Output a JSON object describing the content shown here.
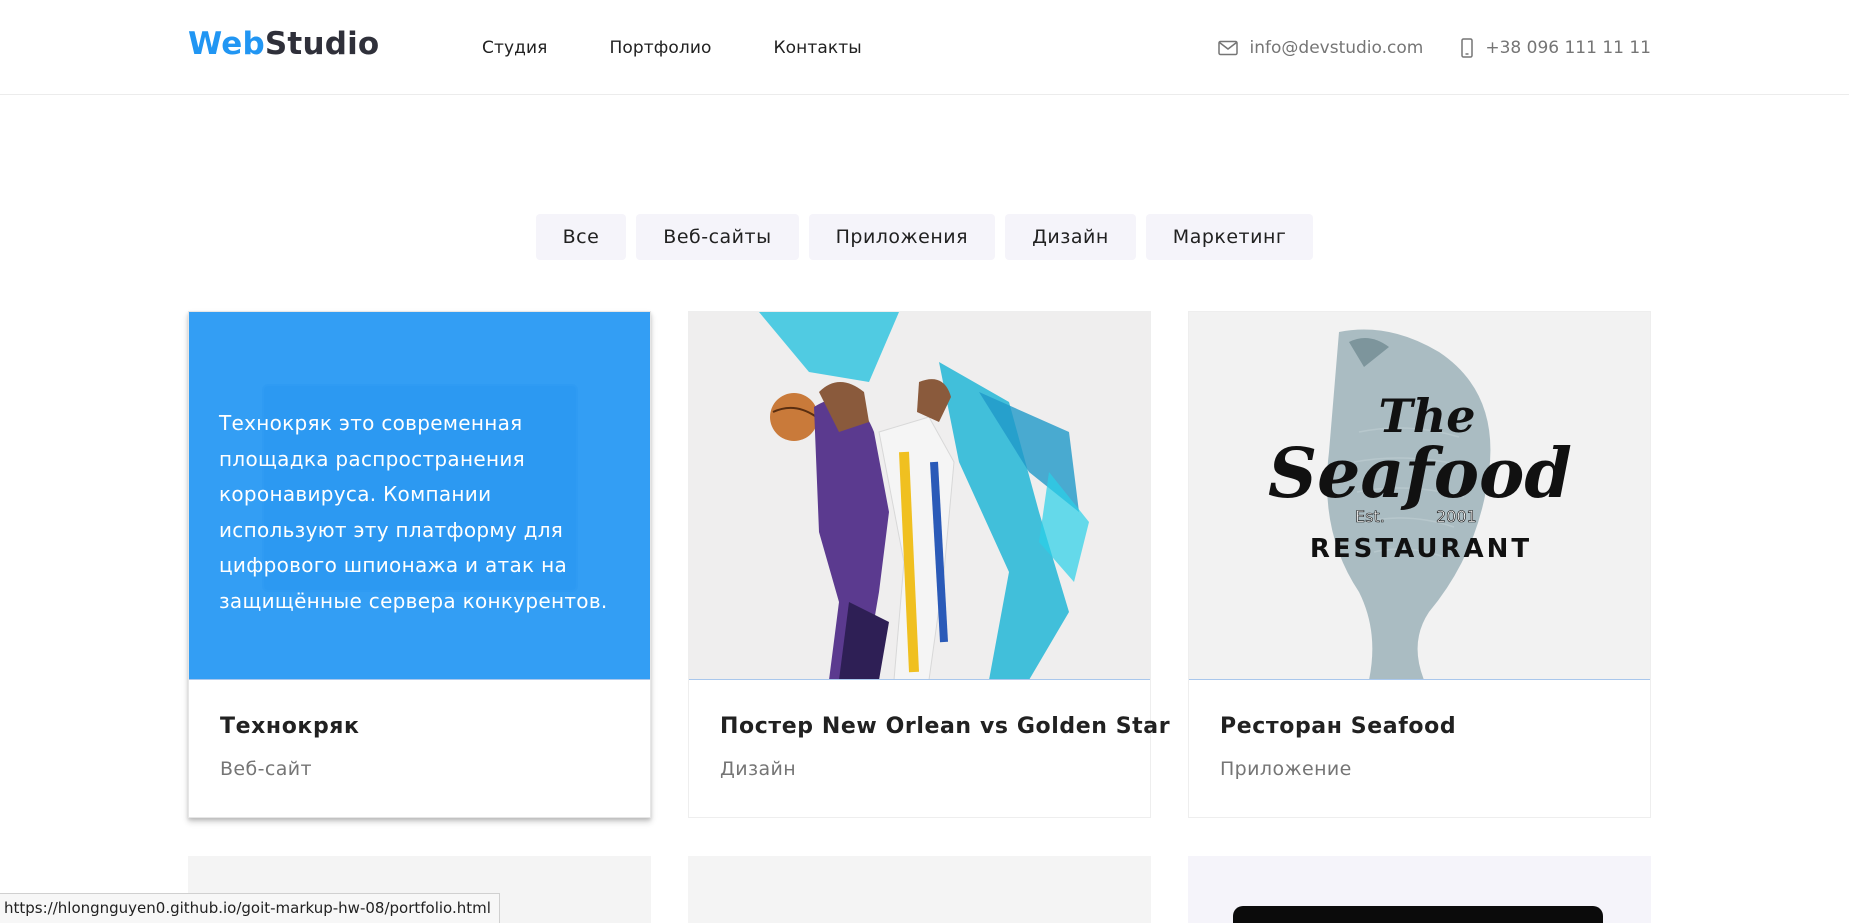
{
  "header": {
    "logo_part1": "Web",
    "logo_part2": "Studio",
    "nav": [
      "Студия",
      "Портфолио",
      "Контакты"
    ],
    "email": "info@devstudio.com",
    "phone": "+38 096 111 11 11",
    "email_icon": "envelope-icon",
    "phone_icon": "smartphone-icon"
  },
  "filters": [
    "Все",
    "Веб-сайты",
    "Приложения",
    "Дизайн",
    "Маркетинг"
  ],
  "cards": [
    {
      "title": "Технокряк",
      "category": "Веб-сайт",
      "overlay_text": "Технокряк это современная площадка распространения коронавируса. Компании используют эту платформу для цифрового шпионажа и атак на защищённые сервера конкурентов."
    },
    {
      "title": "Постер New Orlean vs Golden Star",
      "category": "Дизайн"
    },
    {
      "title": "Ресторан Seafood",
      "category": "Приложение",
      "logo_text": {
        "the": "The",
        "seafood": "Seafood",
        "est": "Est.",
        "year": "2001",
        "restaurant": "RESTAURANT"
      }
    }
  ],
  "status_url": "https://hlongnguyen0.github.io/goit-markup-hw-08/portfolio.html",
  "colors": {
    "accent": "#2196f3",
    "text": "#212121",
    "muted": "#757575",
    "filter_bg": "#f5f4fa"
  }
}
